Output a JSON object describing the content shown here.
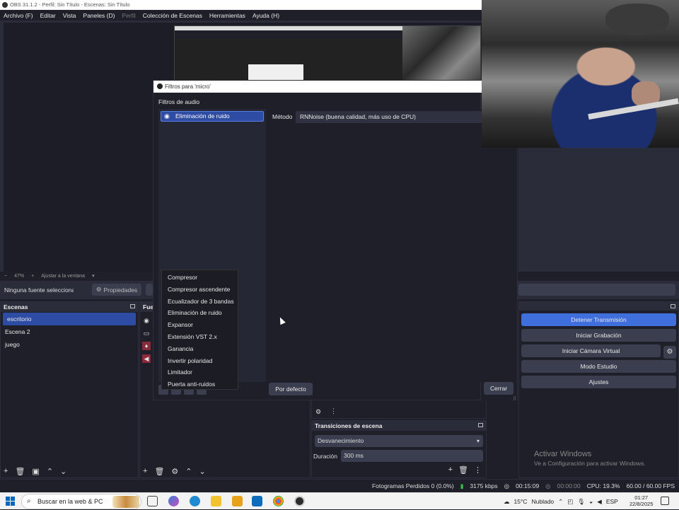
{
  "window": {
    "title": "OBS 31.1.2 - Perfil: Sin Título - Escenas: Sin Título"
  },
  "menu": [
    {
      "label": "Archivo (F)",
      "dim": false
    },
    {
      "label": "Editar",
      "dim": false
    },
    {
      "label": "Vista",
      "dim": false
    },
    {
      "label": "Paneles (D)",
      "dim": false
    },
    {
      "label": "Perfil",
      "dim": true
    },
    {
      "label": "Colección de Escenas",
      "dim": false
    },
    {
      "label": "Herramientas",
      "dim": false
    },
    {
      "label": "Ayuda (H)",
      "dim": false
    }
  ],
  "preview": {
    "zoom": "47%",
    "fit_label": "Ajustar a la ventana",
    "minus": "−",
    "plus": "+"
  },
  "source_toolbar": {
    "no_source": "Ninguna fuente seleccionada",
    "properties": "Propiedades"
  },
  "scenes": {
    "title": "Escenas",
    "items": [
      "escritorio",
      "Escena 2",
      "juego"
    ]
  },
  "sources": {
    "title": "Fue"
  },
  "transitions": {
    "title": "Transiciones de escena",
    "selected": "Desvanecimiento",
    "duration_label": "Duración",
    "duration_value": "300 ms"
  },
  "controls": {
    "buttons": [
      "Detener Transmisión",
      "Iniciar Grabación",
      "Iniciar Cámara Virtual",
      "Modo Estudio",
      "Ajustes"
    ]
  },
  "watermark": {
    "title": "Activar Windows",
    "subtitle": "Ve a Configuración para activar Windows."
  },
  "status": {
    "dropped": "Fotogramas Perdidos 0 (0.0%)",
    "bitrate": "3175 kbps",
    "stream_time": "00:15:09",
    "rec_time": "00:00:00",
    "cpu": "CPU: 19.3%",
    "fps": "60.00 / 60.00 FPS"
  },
  "taskbar": {
    "search": "Buscar en la web & PC",
    "weather": "15°C",
    "weather_desc": "Nublado",
    "lang": "ESP",
    "time": "01:27",
    "date": "22/8/2025"
  },
  "dialog": {
    "title": "Filtros para 'micro'",
    "section": "Filtros de audio",
    "filter_item": "Eliminación de ruido",
    "method_label": "Método",
    "method_value": "RNNoise (buena calidad, más uso de CPU)",
    "defaults_button": "Por defecto",
    "close_button": "Cerrar"
  },
  "context_menu": {
    "items": [
      "Compresor",
      "Compresor ascendente",
      "Ecualizador de 3 bandas",
      "Eliminación de ruido",
      "Expansor",
      "Extensión VST 2.x",
      "Ganancia",
      "Invertir polaridad",
      "Limitador",
      "Puerta anti-ruidos"
    ]
  },
  "colors": {
    "accent": "#3e6fdc",
    "selection": "#2e4ca3",
    "bg": "#1e1f29"
  }
}
